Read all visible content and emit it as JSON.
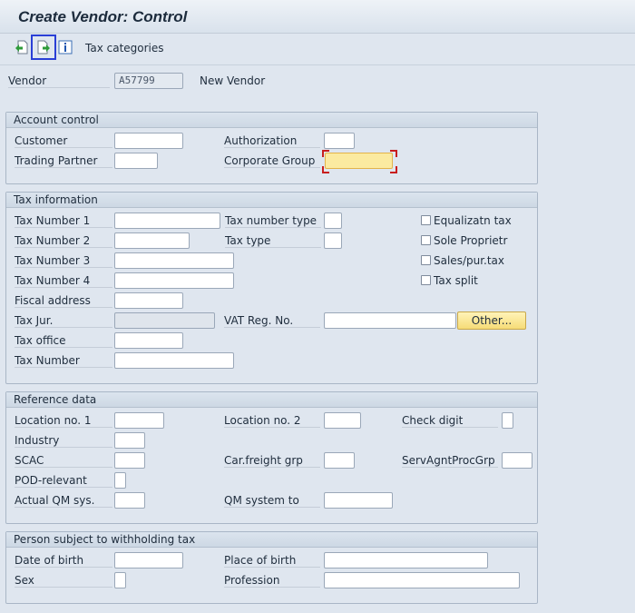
{
  "window": {
    "title": "Create Vendor: Control"
  },
  "toolbar": {
    "icons": [
      "previous-screen-icon",
      "next-screen-icon",
      "info-icon"
    ],
    "tax_categories_label": "Tax categories"
  },
  "vendor": {
    "label": "Vendor",
    "value": "A57799",
    "description": "New Vendor"
  },
  "account_control": {
    "title": "Account control",
    "customer_label": "Customer",
    "trading_partner_label": "Trading Partner",
    "authorization_label": "Authorization",
    "corporate_group_label": "Corporate Group"
  },
  "tax_information": {
    "title": "Tax information",
    "tax_number_1": "Tax Number 1",
    "tax_number_2": "Tax Number 2",
    "tax_number_3": "Tax Number 3",
    "tax_number_4": "Tax Number 4",
    "fiscal_address": "Fiscal address",
    "tax_jur": "Tax Jur.",
    "tax_office": "Tax office",
    "tax_number": "Tax Number",
    "tax_number_type": "Tax number type",
    "tax_type": "Tax type",
    "vat_reg_no": "VAT Reg. No.",
    "other_button": "Other...",
    "equalization_tax": "Equalizatn tax",
    "sole_proprietor": "Sole Proprietr",
    "sales_pur_tax": "Sales/pur.tax",
    "tax_split": "Tax split"
  },
  "reference_data": {
    "title": "Reference data",
    "location_no_1": "Location no. 1",
    "location_no_2": "Location no. 2",
    "check_digit": "Check digit",
    "industry": "Industry",
    "scac": "SCAC",
    "car_freight_grp": "Car.freight grp",
    "serv_agnt_proc_grp": "ServAgntProcGrp",
    "pod_relevant": "POD-relevant",
    "actual_qm_sys": "Actual QM sys.",
    "qm_system_to": "QM system to"
  },
  "withholding": {
    "title": "Person subject to withholding tax",
    "date_of_birth": "Date of birth",
    "place_of_birth": "Place of birth",
    "sex": "Sex",
    "profession": "Profession"
  },
  "colors": {
    "background": "#dfe6ef",
    "focus_field": "#fbeaa0",
    "button": "#f6dc77",
    "selection_outline": "#2a3fd6"
  }
}
